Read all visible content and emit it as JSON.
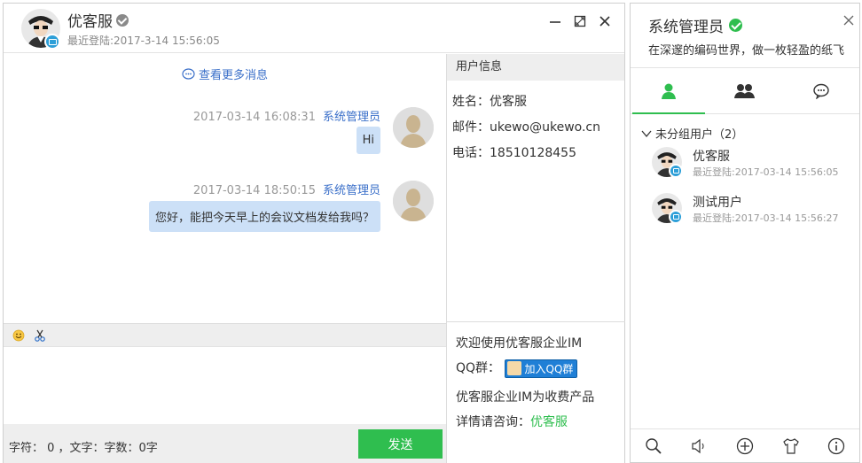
{
  "chat": {
    "peer_name": "优客服",
    "last_login": "最近登陆:2017-3-14 15:56:05",
    "more_messages": "查看更多消息",
    "messages": [
      {
        "time": "2017-03-14 16:08:31",
        "sender": "系统管理员",
        "text": "Hi"
      },
      {
        "time": "2017-03-14 18:50:15",
        "sender": "系统管理员",
        "text": "您好，能把今天早上的会议文档发给我吗？"
      }
    ],
    "counter": "字符： 0 ，文字：字数：0字",
    "send_label": "发送"
  },
  "user_info": {
    "title": "用户信息",
    "name": "姓名：优客服",
    "email": "邮件：ukewo@ukewo.cn",
    "phone": "电话：18510128455"
  },
  "promo": {
    "welcome": "欢迎使用优客服企业IM",
    "qq_label": "QQ群：",
    "qq_button": "加入QQ群",
    "paid": "优客服企业IM为收费产品",
    "consult_prefix": "详情请咨询：",
    "consult_link": "优客服"
  },
  "side": {
    "my_name": "系统管理员",
    "signature": "在深邃的编码世界，做一枚轻盈的纸飞",
    "group": "未分组用户（2）",
    "contacts": [
      {
        "name": "优客服",
        "login": "最近登陆:2017-03-14 15:56:05"
      },
      {
        "name": "测试用户",
        "login": "最近登陆:2017-03-14 15:56:27"
      }
    ]
  },
  "colors": {
    "accent_green": "#2fbe4f",
    "bubble_blue": "#cce0f7",
    "link_blue": "#3a6fc9"
  }
}
